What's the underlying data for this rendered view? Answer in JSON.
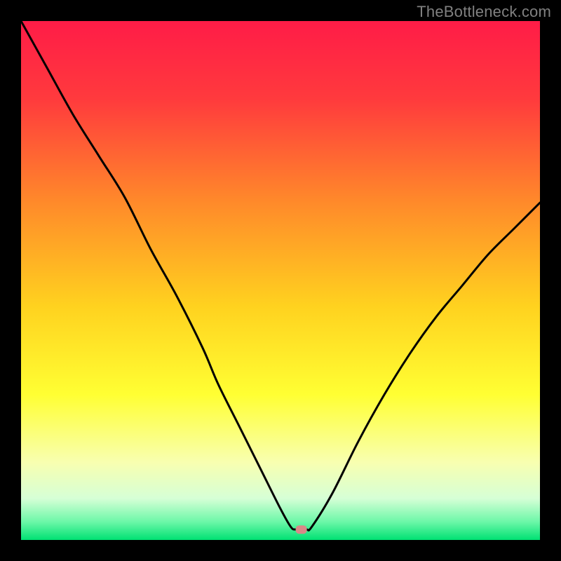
{
  "watermark": "TheBottleneck.com",
  "chart_data": {
    "type": "line",
    "title": "",
    "xlabel": "",
    "ylabel": "",
    "xlim": [
      0,
      100
    ],
    "ylim": [
      0,
      100
    ],
    "grid": false,
    "legend": false,
    "background_gradient_stops": [
      {
        "offset": 0.0,
        "color": "#ff1c47"
      },
      {
        "offset": 0.15,
        "color": "#ff3a3d"
      },
      {
        "offset": 0.35,
        "color": "#ff8a2a"
      },
      {
        "offset": 0.55,
        "color": "#ffd21f"
      },
      {
        "offset": 0.72,
        "color": "#ffff33"
      },
      {
        "offset": 0.85,
        "color": "#f8ffb0"
      },
      {
        "offset": 0.92,
        "color": "#d6ffd6"
      },
      {
        "offset": 0.965,
        "color": "#6cf7a8"
      },
      {
        "offset": 1.0,
        "color": "#00e173"
      }
    ],
    "x": [
      0,
      5,
      10,
      15,
      20,
      25,
      30,
      35,
      38,
      42,
      46,
      50,
      52,
      53,
      55,
      56,
      60,
      65,
      70,
      75,
      80,
      85,
      90,
      95,
      100
    ],
    "values": [
      100,
      91,
      82,
      74,
      66,
      56,
      47,
      37,
      30,
      22,
      14,
      6,
      2.5,
      2,
      2,
      2.5,
      9,
      19,
      28,
      36,
      43,
      49,
      55,
      60,
      65
    ],
    "valley_marker": {
      "x": 54,
      "y": 2,
      "color": "#d98888"
    }
  }
}
